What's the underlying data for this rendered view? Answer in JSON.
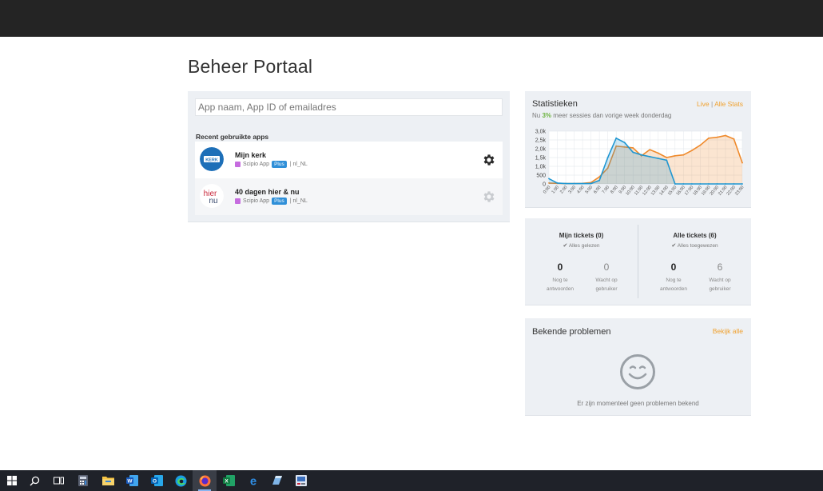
{
  "header": {
    "title": "Beheer Portaal"
  },
  "search": {
    "placeholder": "App naam, App ID of emailadres"
  },
  "recent": {
    "label": "Recent gebruikte apps",
    "apps": [
      {
        "name": "Mijn kerk",
        "type": "Scipio App",
        "badge": "Plus",
        "locale": "| nl_NL",
        "logo_text": "KERK"
      },
      {
        "name": "40 dagen hier & nu",
        "type": "Scipio App",
        "badge": "Plus",
        "locale": "| nl_NL",
        "logo_text": "hier nu"
      }
    ]
  },
  "stats": {
    "title": "Statistieken",
    "link_live": "Live",
    "separator": "|",
    "link_all": "Alle Stats",
    "sub_prefix": "Nu",
    "sub_pct": "3%",
    "sub_suffix": "meer sessies dan vorige week donderdag"
  },
  "chart_data": {
    "type": "area",
    "x": [
      "0:00",
      "1:00",
      "2:00",
      "3:00",
      "4:00",
      "5:00",
      "6:00",
      "7:00",
      "8:00",
      "9:00",
      "10:00",
      "11:00",
      "12:00",
      "13:00",
      "14:00",
      "15:00",
      "16:00",
      "17:00",
      "18:00",
      "19:00",
      "20:00",
      "21:00",
      "22:00",
      "23:00"
    ],
    "yticks": [
      "0",
      "500",
      "1,0k",
      "1,5k",
      "2,0k",
      "2,5k",
      "3,0k"
    ],
    "ylim": [
      0,
      3000
    ],
    "series": [
      {
        "color": "#ef8a2c",
        "values": [
          50,
          30,
          20,
          20,
          30,
          80,
          400,
          900,
          2150,
          2100,
          2050,
          1600,
          1950,
          1750,
          1500,
          1600,
          1650,
          1900,
          2200,
          2600,
          2650,
          2750,
          2550,
          1200
        ]
      },
      {
        "color": "#1f96d1",
        "values": [
          300,
          50,
          20,
          20,
          20,
          20,
          200,
          1500,
          2600,
          2350,
          1800,
          1650,
          1550,
          1450,
          1350,
          0,
          0,
          0,
          0,
          0,
          0,
          0,
          0,
          0
        ]
      }
    ],
    "grid": true
  },
  "tickets": {
    "mine": {
      "title": "Mijn tickets (0)",
      "sub": "Alles gelezen",
      "count_a": "0",
      "cap_a1": "Nog te",
      "cap_a2": "antwoorden",
      "count_b": "0",
      "cap_b1": "Wacht op",
      "cap_b2": "gebruiker"
    },
    "all": {
      "title": "Alle tickets (6)",
      "sub": "Alles toegewezen",
      "count_a": "0",
      "cap_a1": "Nog te",
      "cap_a2": "antwoorden",
      "count_b": "6",
      "cap_b1": "Wacht op",
      "cap_b2": "gebruiker"
    }
  },
  "problems": {
    "title": "Bekende problemen",
    "link": "Bekijk alle",
    "empty": "Er zijn momenteel geen problemen bekend"
  },
  "taskbar": {
    "icons": [
      "windows-icon",
      "search-icon",
      "task-view-icon",
      "calculator-icon",
      "file-explorer-icon",
      "word-icon",
      "outlook-icon",
      "edge-icon",
      "firefox-icon",
      "excel-icon",
      "edge-legacy-icon",
      "app-icon",
      "remote-desktop-icon"
    ]
  }
}
